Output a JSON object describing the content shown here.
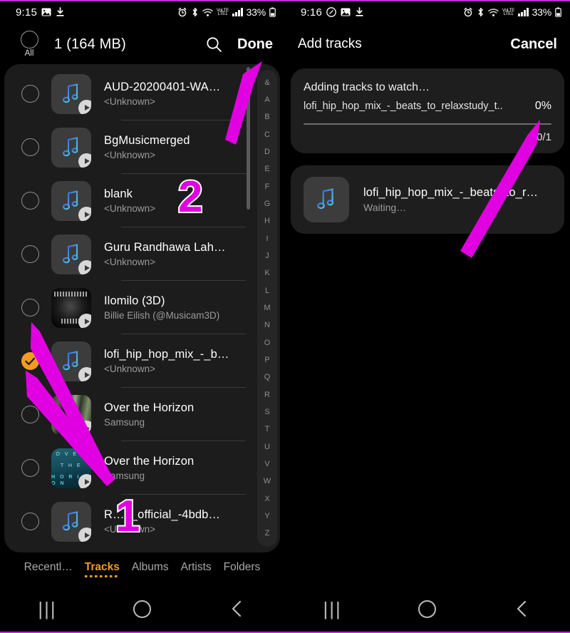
{
  "left": {
    "status": {
      "time": "9:15",
      "icons": [
        "image-icon",
        "download-icon"
      ],
      "right_icons": [
        "alarm-icon",
        "bluetooth-icon",
        "wifi-icon",
        "volte-icon",
        "signal-icon"
      ],
      "volte_label_top": "VoLTE",
      "volte_label_bottom": "LTE1",
      "battery": "33%"
    },
    "header": {
      "all_label": "All",
      "count": "1 (164 MB)",
      "search_icon": "search-icon",
      "done_label": "Done"
    },
    "tracks": [
      {
        "title": "AUD-20200401-WA…",
        "artist": "<Unknown>",
        "selected": false,
        "art": "note"
      },
      {
        "title": "BgMusicmerged",
        "artist": "<Unknown>",
        "selected": false,
        "art": "note"
      },
      {
        "title": "blank",
        "artist": "<Unknown>",
        "selected": false,
        "art": "note"
      },
      {
        "title": "Guru Randhawa Lah…",
        "artist": "<Unknown>",
        "selected": false,
        "art": "note"
      },
      {
        "title": "Ilomilo (3D)",
        "artist": "Billie Eilish (@Musicam3D)",
        "selected": false,
        "art": "ilomilo"
      },
      {
        "title": "lofi_hip_hop_mix_-_b…",
        "artist": "<Unknown>",
        "selected": true,
        "art": "note"
      },
      {
        "title": "Over the Horizon",
        "artist": "Samsung",
        "selected": false,
        "art": "forest"
      },
      {
        "title": "Over the Horizon",
        "artist": "Samsung",
        "selected": false,
        "art": "horizon"
      },
      {
        "title": "R…g_official_-4bdb…",
        "artist": "<Unknown>",
        "selected": false,
        "art": "note"
      }
    ],
    "alpha_index": [
      "&",
      "A",
      "B",
      "C",
      "D",
      "E",
      "F",
      "G",
      "H",
      "I",
      "J",
      "K",
      "L",
      "M",
      "N",
      "O",
      "P",
      "Q",
      "R",
      "S",
      "T",
      "U",
      "V",
      "W",
      "X",
      "Y",
      "Z"
    ],
    "tabs": [
      {
        "label": "Recentl…",
        "active": false
      },
      {
        "label": "Tracks",
        "active": true
      },
      {
        "label": "Albums",
        "active": false
      },
      {
        "label": "Artists",
        "active": false
      },
      {
        "label": "Folders",
        "active": false
      }
    ],
    "horizon_art_lines": [
      "O V E R",
      "T H E",
      "H O R I Z O N"
    ]
  },
  "right": {
    "status": {
      "time": "9:16",
      "battery": "33%",
      "volte_label_top": "VoLTE",
      "volte_label_bottom": "LTE1"
    },
    "header": {
      "title": "Add tracks",
      "cancel_label": "Cancel"
    },
    "progress": {
      "heading": "Adding tracks to watch…",
      "filename": "lofi_hip_hop_mix_-_beats_to_relaxstudy_t..",
      "percent_label": "0%",
      "percent_value": 0,
      "count_label": "0/1"
    },
    "queued": {
      "title": "lofi_hip_hop_mix_-_beats_to_r…",
      "status": "Waiting…",
      "art": "note"
    }
  },
  "navbar": {
    "recents_icon": "recents-icon",
    "home_icon": "home-icon",
    "back_icon": "back-icon"
  },
  "annotations": {
    "marker_one": "1",
    "marker_two": "2",
    "accent_color": "#E100E1"
  },
  "colors": {
    "accent_orange": "#F29D21",
    "card_bg": "#1e1e1e",
    "list_bg": "#1c1c1c"
  }
}
